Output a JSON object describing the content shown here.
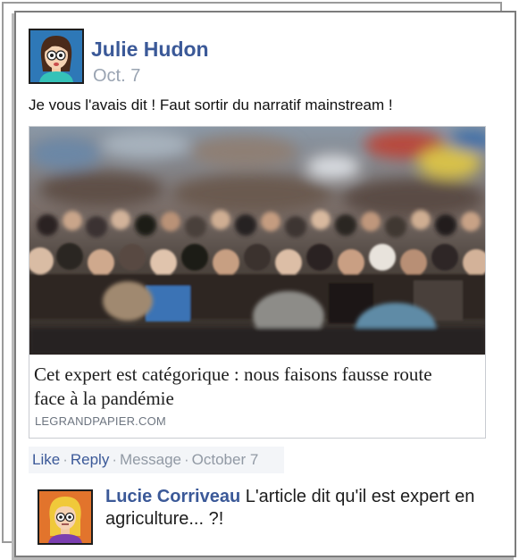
{
  "post": {
    "author": "Julie Hudon",
    "date": "Oct. 7",
    "text": "Je vous l'avais dit ! Faut sortir du narratif mainstream !",
    "avatar_icon": "cartoon-woman-avatar-icon"
  },
  "link": {
    "title": "Cet expert est catégorique : nous faisons fausse route face à la pandémie",
    "domain": "LEGRANDPAPIER.COM",
    "image": "crowd-photo"
  },
  "actions": {
    "like": "Like",
    "reply": "Reply",
    "message": "Message",
    "date": "October 7",
    "separator": "·"
  },
  "comment": {
    "author": "Lucie Corriveau",
    "text": "L'article dit qu'il est expert en agriculture... ?!",
    "avatar_icon": "cartoon-blonde-woman-avatar-icon"
  },
  "colors": {
    "link_blue": "#3b5998",
    "muted_gray": "#9aa4b2",
    "author_avatar_bg": "#2e78b7",
    "comment_avatar_bg": "#e2742c"
  }
}
